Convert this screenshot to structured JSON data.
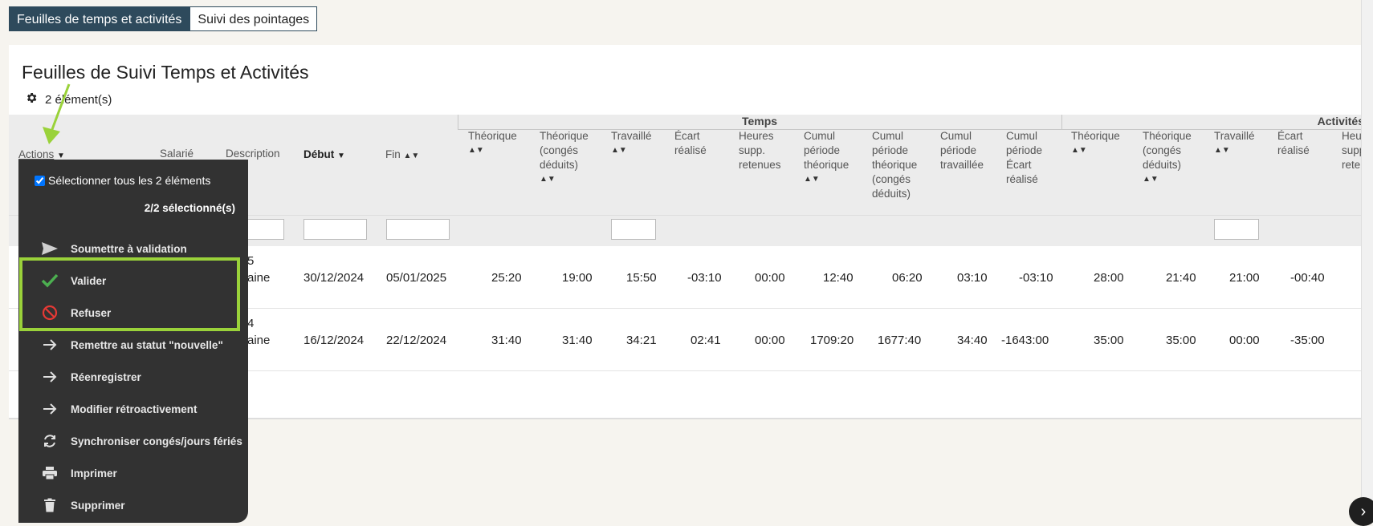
{
  "tabs": [
    "Feuilles de temps et activités",
    "Suivi des pointages"
  ],
  "page_title": "Feuilles de Suivi Temps et Activités",
  "element_count": "2 élément(s)",
  "groups": {
    "temps": "Temps",
    "activites": "Activités"
  },
  "columns": {
    "actions": "Actions",
    "salarie": "Salarié",
    "description": "Description",
    "debut": "Début",
    "fin": "Fin",
    "theo": "Théorique",
    "theo_conges": "Théorique (congés déduits)",
    "travaille": "Travaillé",
    "ecart": "Écart réalisé",
    "heures_supp": "Heures supp. retenues",
    "cumul_theo": "Cumul période théorique",
    "cumul_theo_conges": "Cumul période théorique (congés déduits)",
    "cumul_trav": "Cumul période travaillée",
    "cumul_ecart": "Cumul période Écart réalisé",
    "a_theo": "Théorique",
    "a_theo_conges": "Théorique (congés déduits)",
    "a_travaille": "Travaillé",
    "a_ecart": "Écart réalisé",
    "a_heures_supp": "Heures supp. rete"
  },
  "rows": [
    {
      "sal_frag": "5",
      "desc_frag": "aine",
      "debut": "30/12/2024",
      "fin": "05/01/2025",
      "theo": "25:20",
      "theo_conges": "19:00",
      "travaille": "15:50",
      "ecart": "-03:10",
      "heures_supp": "00:00",
      "cumul_theo": "12:40",
      "cumul_theo_conges": "06:20",
      "cumul_trav": "03:10",
      "cumul_ecart": "-03:10",
      "a_theo": "28:00",
      "a_theo_conges": "21:40",
      "a_travaille": "21:00",
      "a_ecart": "-00:40"
    },
    {
      "sal_frag": "4",
      "desc_frag": "aine",
      "debut": "16/12/2024",
      "fin": "22/12/2024",
      "theo": "31:40",
      "theo_conges": "31:40",
      "travaille": "34:21",
      "ecart": "02:41",
      "heures_supp": "00:00",
      "cumul_theo": "1709:20",
      "cumul_theo_conges": "1677:40",
      "cumul_trav": "34:40",
      "cumul_ecart": "-1643:00",
      "a_theo": "35:00",
      "a_theo_conges": "35:00",
      "a_travaille": "00:00",
      "a_ecart": "-35:00"
    }
  ],
  "actions_menu": {
    "select_all": "Sélectionner tous les 2 éléments",
    "selected_count": "2/2 sélectionné(s)",
    "items": [
      {
        "label": "Soumettre à validation",
        "icon": "send-icon"
      },
      {
        "label": "Valider",
        "icon": "check-icon"
      },
      {
        "label": "Refuser",
        "icon": "forbidden-icon"
      },
      {
        "label": "Remettre au statut \"nouvelle\"",
        "icon": "arrow-right-icon"
      },
      {
        "label": "Réenregistrer",
        "icon": "arrow-right-icon"
      },
      {
        "label": "Modifier rétroactivement",
        "icon": "arrow-right-icon"
      },
      {
        "label": "Synchroniser congés/jours fériés",
        "icon": "sync-icon"
      },
      {
        "label": "Imprimer",
        "icon": "printer-icon"
      },
      {
        "label": "Supprimer",
        "icon": "trash-icon"
      }
    ]
  },
  "colors": {
    "tab_active": "#2e4a5c",
    "highlight": "#9ad23a",
    "annotation_arrow": "#9ad23a",
    "check": "#4caf50",
    "forbidden": "#e53935"
  }
}
